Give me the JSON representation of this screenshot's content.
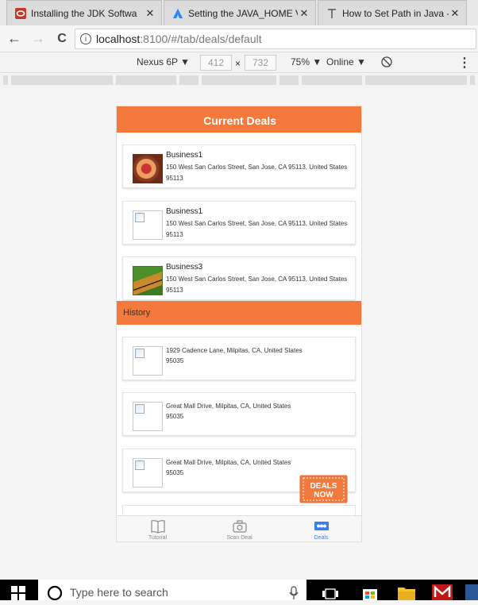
{
  "browser": {
    "tabs": [
      {
        "title": "Installing the JDK Softwa",
        "icon": "oracle-icon",
        "color": "#c0392b"
      },
      {
        "title": "Setting the JAVA_HOME V",
        "icon": "atlassian-icon",
        "color": "#2684ff"
      },
      {
        "title": "How to Set Path in Java -",
        "icon": "text-t-icon",
        "color": "#555555"
      }
    ],
    "close_glyph": "✕",
    "url": {
      "host": "localhost",
      "path": ":8100/#/tab/deals/default"
    },
    "nav": {
      "back": "←",
      "forward": "→",
      "reload": "C"
    }
  },
  "devtools": {
    "device": "Nexus 6P ▼",
    "width": "412",
    "times": "×",
    "height": "732",
    "zoom": "75% ▼",
    "network": "Online ▼",
    "menu": "⋮"
  },
  "app": {
    "header_title": "Current Deals",
    "current_deals": [
      {
        "title": "Business1",
        "address": "150 West San Carlos Street, San Jose, CA 95113, United States",
        "zip": "95113",
        "image": "pizza"
      },
      {
        "title": "Business1",
        "address": "150 West San Carlos Street, San Jose, CA 95113, United States",
        "zip": "95113",
        "image": "broken"
      },
      {
        "title": "Business3",
        "address": "150 West San Carlos Street, San Jose, CA 95113, United States",
        "zip": "95113",
        "image": "tiger"
      }
    ],
    "history_title": "History",
    "history": [
      {
        "address": "1929 Cadence Lane, Milpitas, CA, United States",
        "zip": "95035"
      },
      {
        "address": "Great Mall Drive, Milpitas, CA, United States",
        "zip": "95035"
      },
      {
        "address": "Great Mall Drive, Milpitas, CA, United States",
        "zip": "95035"
      }
    ],
    "deals_now_badge": {
      "line1": "DEALS",
      "line2": "NOW",
      "color": "#f4793c"
    },
    "tabs": [
      {
        "label": "Tutorial",
        "icon": "book-icon"
      },
      {
        "label": "Scan Deal",
        "icon": "camera-icon"
      },
      {
        "label": "Deals",
        "icon": "ticket-icon",
        "active": true
      }
    ],
    "accent_color": "#f4793c",
    "active_tab_color": "#387ef5"
  },
  "taskbar": {
    "search_placeholder": "Type here to search"
  }
}
